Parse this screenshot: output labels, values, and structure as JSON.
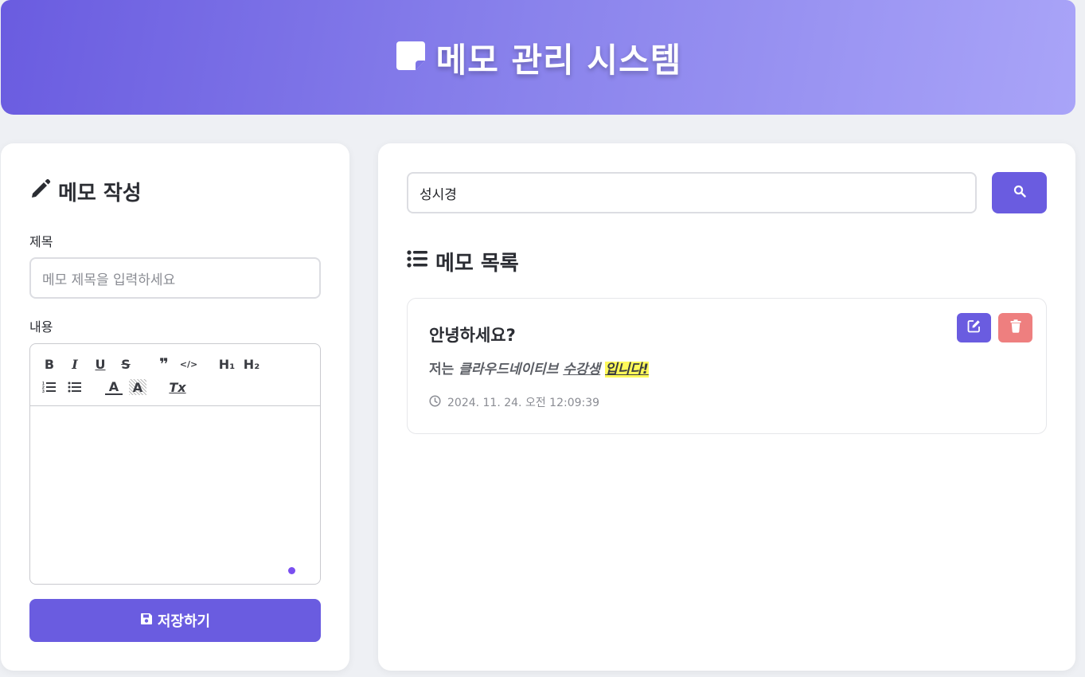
{
  "header": {
    "title": "메모 관리 시스템",
    "icon": "sticky-note-icon"
  },
  "editor_panel": {
    "heading": "메모 작성",
    "heading_icon": "pencil-icon",
    "title_label": "제목",
    "title_placeholder": "메모 제목을 입력하세요",
    "title_value": "",
    "content_label": "내용",
    "toolbar": {
      "bold": "B",
      "italic": "I",
      "underline": "U",
      "strike": "S",
      "blockquote": "❞",
      "code": "</>",
      "h1": "H₁",
      "h2": "H₂",
      "ordered_list": "ordered-list-icon",
      "bullet_list": "bullet-list-icon",
      "text_color": "A",
      "background_color": "A",
      "clear_format": "Tx"
    },
    "save_label": "저장하기"
  },
  "list_panel": {
    "search_value": "성시경",
    "heading": "메모 목록",
    "heading_icon": "list-icon",
    "memos": [
      {
        "title": "안녕하세요?",
        "content_plain": "저는 ",
        "content_italic": "클라우드네이티브",
        "content_space": " ",
        "content_underline": "수강생",
        "content_space2": " ",
        "content_highlight": "입니다!",
        "date": "2024. 11. 24. 오전 12:09:39"
      }
    ]
  },
  "colors": {
    "accent": "#6a5ce0",
    "delete": "#ee7f7f",
    "highlight": "#fff95a",
    "background": "#eef0f4"
  }
}
